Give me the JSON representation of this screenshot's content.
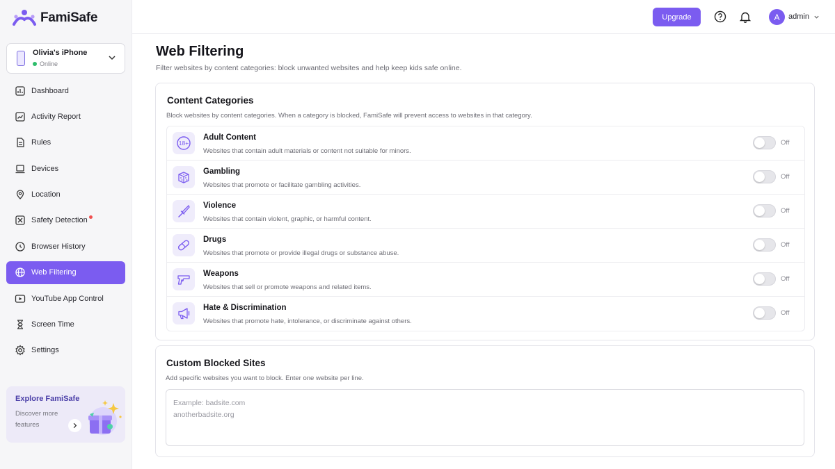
{
  "app": {
    "name": "FamiSafe"
  },
  "device": {
    "name": "Olivia's iPhone",
    "status": "Online"
  },
  "nav": {
    "items": [
      {
        "label": "Dashboard"
      },
      {
        "label": "Activity Report"
      },
      {
        "label": "Rules"
      },
      {
        "label": "Devices"
      },
      {
        "label": "Location"
      },
      {
        "label": "Safety Detection"
      },
      {
        "label": "Browser History"
      },
      {
        "label": "Web Filtering"
      },
      {
        "label": "YouTube App Control"
      },
      {
        "label": "Screen Time"
      },
      {
        "label": "Settings"
      }
    ],
    "active": "Web Filtering"
  },
  "explore": {
    "title": "Explore FamiSafe",
    "desc": "Discover more features"
  },
  "header": {
    "upgrade_label": "Upgrade",
    "user": "admin",
    "avatar_letter": "A"
  },
  "page": {
    "title": "Web Filtering",
    "subtitle": "Filter websites by content categories: block unwanted websites and help keep kids safe online."
  },
  "categories": {
    "title": "Content Categories",
    "desc": "Block websites by content categories. When a category is blocked, FamiSafe will prevent access to websites in that category.",
    "items": [
      {
        "name": "Adult Content",
        "desc": "Websites that contain adult materials or content not suitable for minors.",
        "state": "Off",
        "icon": "18-plus-icon"
      },
      {
        "name": "Gambling",
        "desc": "Websites that promote or facilitate gambling activities.",
        "state": "Off",
        "icon": "dice-icon"
      },
      {
        "name": "Violence",
        "desc": "Websites that contain violent, graphic, or harmful content.",
        "state": "Off",
        "icon": "knife-icon"
      },
      {
        "name": "Drugs",
        "desc": "Websites that promote or provide illegal drugs or substance abuse.",
        "state": "Off",
        "icon": "pill-icon"
      },
      {
        "name": "Weapons",
        "desc": "Websites that sell or promote weapons and related items.",
        "state": "Off",
        "icon": "gun-icon"
      },
      {
        "name": "Hate & Discrimination",
        "desc": "Websites that promote hate, intolerance, or discriminate against others.",
        "state": "Off",
        "icon": "megaphone-icon"
      }
    ]
  },
  "custom": {
    "title": "Custom Blocked Sites",
    "desc": "Add specific websites you want to block. Enter one website per line.",
    "placeholder": "Example: badsite.com\nanotherbadsite.org",
    "value": ""
  },
  "colors": {
    "accent": "#7b5cf0",
    "online": "#2ebd6b",
    "notification": "#f05050"
  }
}
